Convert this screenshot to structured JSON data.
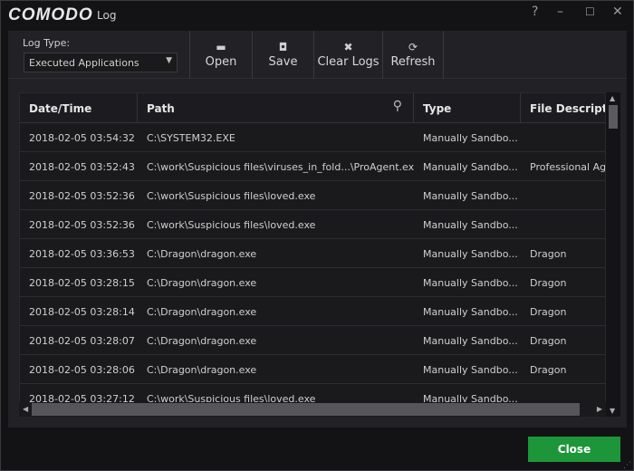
{
  "window": {
    "brand": "COMODO",
    "title": "Log",
    "help": "?",
    "minimize": "–",
    "maximize": "☐",
    "close": "✕"
  },
  "toolbar": {
    "log_type_label": "Log Type:",
    "log_type_value": "Executed Applications",
    "buttons": [
      {
        "label": "Open",
        "icon": "folder-icon"
      },
      {
        "label": "Save",
        "icon": "save-icon"
      },
      {
        "label": "Clear Logs",
        "icon": "clear-icon"
      },
      {
        "label": "Refresh",
        "icon": "refresh-icon"
      }
    ]
  },
  "table": {
    "columns": [
      "Date/Time",
      "Path",
      "Type",
      "File Description"
    ],
    "rows": [
      [
        "2018-02-05 03:54:32",
        "C:\\SYSTEM32.EXE",
        "Manually Sandbo...",
        ""
      ],
      [
        "2018-02-05 03:52:43",
        "C:\\work\\Suspicious files\\viruses_in_fold...\\ProAgent.exe",
        "Manually Sandbo...",
        "Professional Ag"
      ],
      [
        "2018-02-05 03:52:36",
        "C:\\work\\Suspicious files\\loved.exe",
        "Manually Sandbo...",
        ""
      ],
      [
        "2018-02-05 03:52:36",
        "C:\\work\\Suspicious files\\loved.exe",
        "Manually Sandbo...",
        ""
      ],
      [
        "2018-02-05 03:36:53",
        "C:\\Dragon\\dragon.exe",
        "Manually Sandbo...",
        "Dragon"
      ],
      [
        "2018-02-05 03:28:15",
        "C:\\Dragon\\dragon.exe",
        "Manually Sandbo...",
        "Dragon"
      ],
      [
        "2018-02-05 03:28:14",
        "C:\\Dragon\\dragon.exe",
        "Manually Sandbo...",
        "Dragon"
      ],
      [
        "2018-02-05 03:28:07",
        "C:\\Dragon\\dragon.exe",
        "Manually Sandbo...",
        "Dragon"
      ],
      [
        "2018-02-05 03:28:06",
        "C:\\Dragon\\dragon.exe",
        "Manually Sandbo...",
        "Dragon"
      ],
      [
        "2018-02-05 03:27:12",
        "C:\\work\\Suspicious files\\loved.exe",
        "Manually Sandbo...",
        ""
      ]
    ]
  },
  "footer": {
    "close_label": "Close"
  }
}
